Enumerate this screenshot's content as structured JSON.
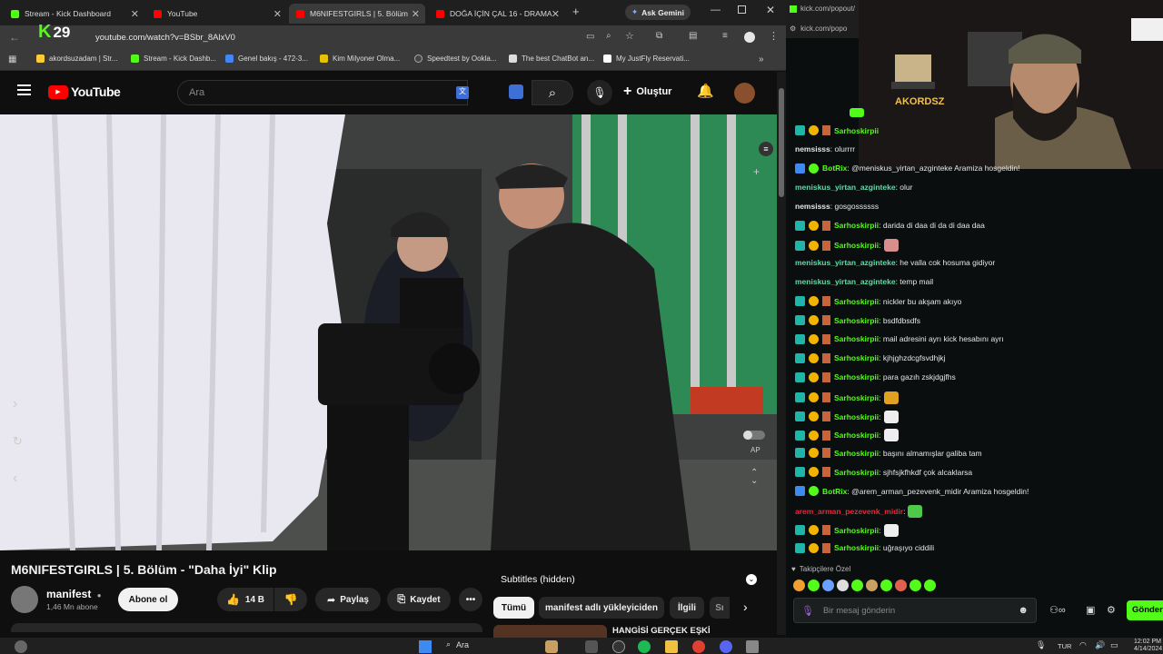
{
  "tabs": [
    {
      "title": "Stream - Kick Dashboard",
      "color": "#53fc18"
    },
    {
      "title": "YouTube",
      "color": "#ff0000"
    },
    {
      "title": "M6NIFESTGIRLS | 5. Bölüm",
      "color": "#ff0000"
    },
    {
      "title": "DOĞA İÇİN ÇAL 16 - DRAMA",
      "color": "#ff0000"
    }
  ],
  "ask_gemini": "Ask Gemini",
  "kick_overlay_number": "29",
  "url": "youtube.com/watch?v=BSbr_8AlxV0",
  "bookmarks": [
    "akordsuzadam | Str...",
    "Stream - Kick Dashb...",
    "Genel bakış - 472-3...",
    "Kim Milyoner Olma...",
    "Speedtest by Ookla...",
    "The best ChatBot an...",
    "My JustFly Reservati..."
  ],
  "youtube": {
    "logo_text": "YouTube",
    "search_placeholder": "Ara",
    "create_label": "Oluştur",
    "video_title": "M6NIFESTGIRLS | 5. Bölüm - \"Daha İyi\" Klip",
    "channel_name": "manifest",
    "subscribers": "1,46 Mn abone",
    "subscribe_label": "Abone ol",
    "like_count": "14 B",
    "share_label": "Paylaş",
    "save_label": "Kaydet",
    "subtitles_label": "Subtitles (hidden)",
    "chips": [
      "Tümü",
      "manifest adlı yükleyiciden",
      "İlgili",
      "Sı"
    ],
    "next_title_partial": "HANGİSİ GERÇEK EŞKİ",
    "autoplay_label": "AP"
  },
  "kick": {
    "address": "kick.com/popout/",
    "address2": "kick.com/popo",
    "followers_label": "Takipçilere Özel",
    "chat_placeholder": "Bir mesaj gönderin",
    "send_label": "Gönder",
    "messages": [
      {
        "user": "Sarhoskirpii",
        "text": "",
        "badges": "sub",
        "ucolor": "#53fc18"
      },
      {
        "user": "nemsisss",
        "text": ": olurrrr",
        "badges": "none",
        "ucolor": "#e6e6e6"
      },
      {
        "user": "BotRix",
        "text": ": @meniskus_yirtan_azginteke Aramiza hosgeldin!",
        "badges": "bot",
        "ucolor": "#53fc18"
      },
      {
        "user": "meniskus_yirtan_azginteke",
        "text": ": olur",
        "badges": "none",
        "ucolor": "#62d9a8"
      },
      {
        "user": "nemsisss",
        "text": ": gosgossssss",
        "badges": "none",
        "ucolor": "#e6e6e6"
      },
      {
        "user": "Sarhoskirpii",
        "text": ": darida di daa di da di daa daa",
        "badges": "sub",
        "ucolor": "#53fc18"
      },
      {
        "user": "Sarhoskirpii",
        "text": ":",
        "badges": "sub",
        "ucolor": "#53fc18",
        "emote": "#d98e8e"
      },
      {
        "user": "meniskus_yirtan_azginteke",
        "text": ": he valla cok hosuma gidiyor",
        "badges": "none",
        "ucolor": "#62d9a8"
      },
      {
        "user": "meniskus_yirtan_azginteke",
        "text": ": temp mail",
        "badges": "none",
        "ucolor": "#62d9a8"
      },
      {
        "user": "Sarhoskirpii",
        "text": ": nickler bu akşam akıyo",
        "badges": "sub",
        "ucolor": "#53fc18"
      },
      {
        "user": "Sarhoskirpii",
        "text": ": bsdfdbsdfs",
        "badges": "sub",
        "ucolor": "#53fc18"
      },
      {
        "user": "Sarhoskirpii",
        "text": ": mail adresini ayrı kick hesabını ayrı",
        "badges": "sub",
        "ucolor": "#53fc18"
      },
      {
        "user": "Sarhoskirpii",
        "text": ": kjhjghzdcgfsvdhjkj",
        "badges": "sub",
        "ucolor": "#53fc18"
      },
      {
        "user": "Sarhoskirpii",
        "text": ": para gazıh zskjdgjfhs",
        "badges": "sub",
        "ucolor": "#53fc18"
      },
      {
        "user": "Sarhoskirpii",
        "text": ":",
        "badges": "sub",
        "ucolor": "#53fc18",
        "emote": "#e0a020"
      },
      {
        "user": "Sarhoskirpii",
        "text": ":",
        "badges": "sub",
        "ucolor": "#53fc18",
        "emote": "#eeeeee"
      },
      {
        "user": "Sarhoskirpii",
        "text": ":",
        "badges": "sub",
        "ucolor": "#53fc18",
        "emote": "#eeeeee"
      },
      {
        "user": "Sarhoskirpii",
        "text": ": başını almamışlar galiba tam",
        "badges": "sub",
        "ucolor": "#53fc18"
      },
      {
        "user": "Sarhoskirpii",
        "text": ": sjhfsjkfhkdf çok alcaklarsa",
        "badges": "sub",
        "ucolor": "#53fc18"
      },
      {
        "user": "BotRix",
        "text": ": @arem_arman_pezevenk_midir Aramiza hosgeldin!",
        "badges": "bot",
        "ucolor": "#53fc18"
      },
      {
        "user": "arem_arman_pezevenk_midir",
        "text": ":",
        "badges": "none",
        "ucolor": "#e5293b",
        "emote": "#4fc94a"
      },
      {
        "user": "Sarhoskirpii",
        "text": ":",
        "badges": "sub",
        "ucolor": "#53fc18",
        "emote": "#eeeeee"
      },
      {
        "user": "Sarhoskirpii",
        "text": ": uğraşıyo ciddili",
        "badges": "sub",
        "ucolor": "#53fc18"
      }
    ]
  },
  "taskbar": {
    "search_label": "Ara",
    "lang": "TUR",
    "time": "12:02 PM",
    "date": "4/14/2024"
  },
  "colors": {
    "kick_green": "#53fc18",
    "youtube_red": "#ff0000"
  }
}
